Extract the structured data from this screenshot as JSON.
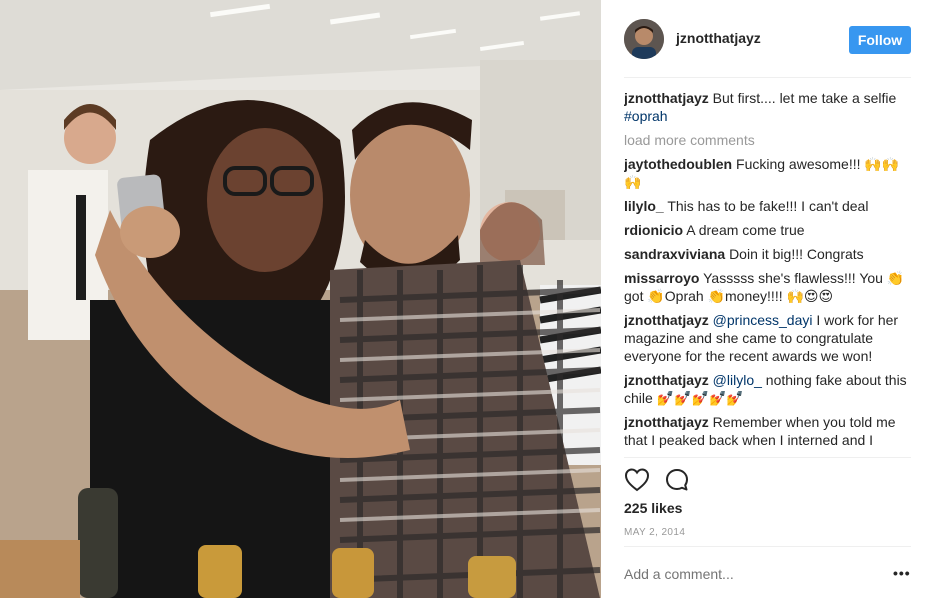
{
  "header": {
    "username": "jznotthatjayz",
    "follow_label": "Follow"
  },
  "caption": {
    "username": "jznotthatjayz",
    "text": "But first.... let me take a selfie",
    "hashtag": "#oprah"
  },
  "load_more_label": "load more comments",
  "comments": [
    {
      "username": "jaytothedoublen",
      "text": "Fucking awesome!!!",
      "emoji": "🙌🙌🙌"
    },
    {
      "username": "lilylo_",
      "text": "This has to be fake!!! I can't deal"
    },
    {
      "username": "rdionicio",
      "text": "A dream come true"
    },
    {
      "username": "sandraxviviana",
      "text": "Doin it big!!! Congrats"
    },
    {
      "username": "missarroyo",
      "text": "Yasssss she's flawless!!! You 👏 got 👏Oprah 👏money!!!! 🙌😍😍"
    },
    {
      "username": "jznotthatjayz",
      "mention": "@princess_dayi",
      "text": "I work for her magazine and she came to congratulate everyone for the recent awards we won!"
    },
    {
      "username": "jznotthatjayz",
      "mention": "@lilylo_",
      "text": "nothing fake about this chile",
      "emoji": "💅💅💅💅💅"
    },
    {
      "username": "jznotthatjayz",
      "text": "Remember when you told me that I peaked back when I interned and I"
    }
  ],
  "actions": {
    "like_icon": "heart-icon",
    "comment_icon": "comment-icon"
  },
  "likes_text": "225 likes",
  "date_text": "MAY 2, 2014",
  "add_comment_placeholder": "Add a comment...",
  "more_label": "•••",
  "colors": {
    "follow_button": "#3897f0",
    "hashtag": "#003569",
    "muted": "#999999",
    "divider": "#efefef"
  }
}
